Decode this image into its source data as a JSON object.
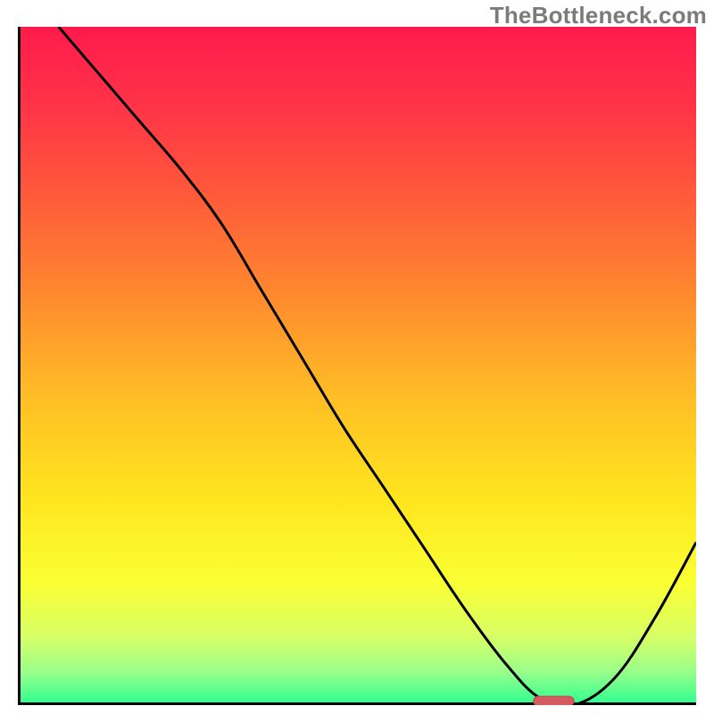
{
  "watermark": "TheBottleneck.com",
  "colors": {
    "axis": "#000000",
    "curve": "#000000",
    "marker_fill": "#d25b5f",
    "marker_stroke": "#c04a50",
    "gradient_stops": [
      {
        "offset": 0.0,
        "color": "#ff1a4c"
      },
      {
        "offset": 0.12,
        "color": "#ff3447"
      },
      {
        "offset": 0.25,
        "color": "#ff5a3a"
      },
      {
        "offset": 0.4,
        "color": "#ff8b2e"
      },
      {
        "offset": 0.55,
        "color": "#ffbf25"
      },
      {
        "offset": 0.7,
        "color": "#ffe61f"
      },
      {
        "offset": 0.82,
        "color": "#faff33"
      },
      {
        "offset": 0.9,
        "color": "#d6ff66"
      },
      {
        "offset": 0.95,
        "color": "#9bff8a"
      },
      {
        "offset": 1.0,
        "color": "#2bff8f"
      }
    ]
  },
  "chart_data": {
    "type": "line",
    "title": "",
    "xlabel": "",
    "ylabel": "",
    "xlim": [
      0,
      100
    ],
    "ylim": [
      0,
      100
    ],
    "note": "Values are approximate; read as percentage of axis range (0 = bottom/left, 100 = top/right).",
    "series": [
      {
        "name": "bottleneck-curve",
        "x": [
          6,
          12,
          18,
          24,
          30,
          36,
          42,
          48,
          54,
          60,
          66,
          72,
          77,
          82,
          88,
          94,
          100
        ],
        "y": [
          100,
          93,
          86,
          79,
          71,
          61,
          51,
          41,
          32,
          23,
          14,
          6,
          1,
          0,
          4,
          13,
          24
        ]
      }
    ],
    "marker": {
      "name": "optimal-point",
      "x": 79,
      "y": 0.6,
      "width_pct": 6,
      "height_pct": 1.4
    }
  }
}
